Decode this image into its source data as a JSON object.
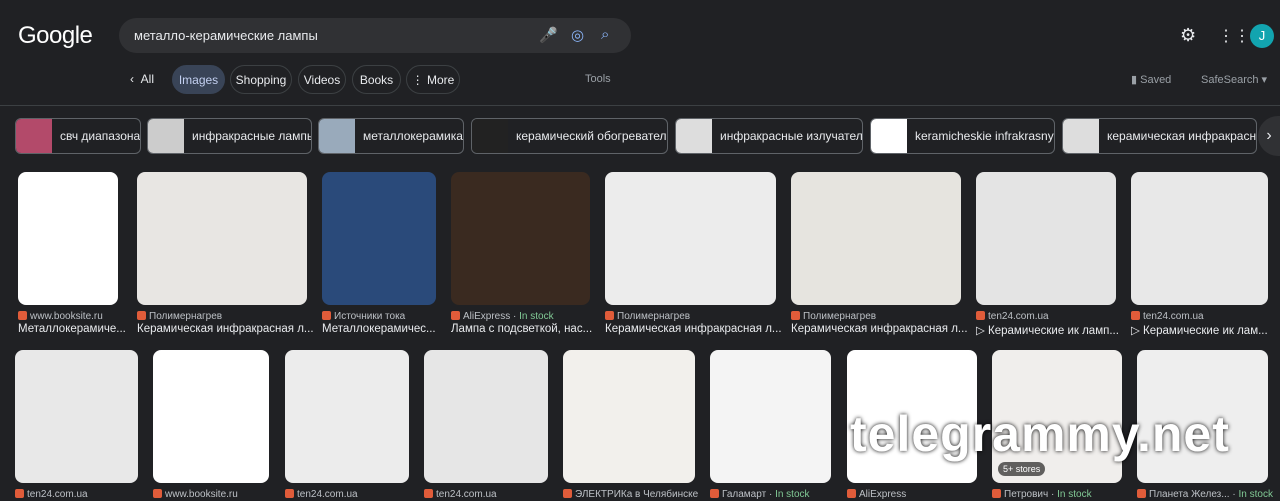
{
  "header": {
    "logo": "Google",
    "query": "металло-керамические лампы",
    "avatar": "J"
  },
  "tabs": [
    {
      "label": "All"
    },
    {
      "label": "Images"
    },
    {
      "label": "Shopping"
    },
    {
      "label": "Videos"
    },
    {
      "label": "Books"
    },
    {
      "label": "More"
    }
  ],
  "tools": "Tools",
  "saved": "Saved",
  "safesearch": "SafeSearch",
  "chips": [
    "свч диапазона",
    "инфракрасные лампы",
    "металлокерамика",
    "керамический обогреватель",
    "инфракрасные излучатели",
    "keramicheskie infrakrasnye",
    "керамическая инфракрасная"
  ],
  "row1": [
    {
      "source": "www.booksite.ru",
      "title": "Металлокерамиче..."
    },
    {
      "source": "Полимернагрев",
      "title": "Керамическая инфракрасная л..."
    },
    {
      "source": "Источники тока",
      "title": "Металлокерамичес..."
    },
    {
      "source": "AliExpress",
      "stock": "In stock",
      "title": "Лампа с подсветкой, нас..."
    },
    {
      "source": "Полимернагрев",
      "title": "Керамическая инфракрасная л..."
    },
    {
      "source": "Полимернагрев",
      "title": "Керамическая инфракрасная л..."
    },
    {
      "source": "ten24.com.ua",
      "title": "▷ Керамические ик ламп..."
    },
    {
      "source": "ten24.com.ua",
      "title": "▷ Керамические ик лам..."
    }
  ],
  "row2": [
    {
      "source": "ten24.com.ua"
    },
    {
      "source": "www.booksite.ru"
    },
    {
      "source": "ten24.com.ua"
    },
    {
      "source": "ten24.com.ua"
    },
    {
      "source": "ЭЛЕКТРИКа в Челябинске"
    },
    {
      "source": "Галамарт",
      "stock": "In stock"
    },
    {
      "source": "AliExpress"
    },
    {
      "source": "Петрович",
      "stock": "In stock",
      "badge": "5+ stores"
    },
    {
      "source": "Планета Желез...",
      "stock": "In stock"
    }
  ],
  "watermark": "telegrammy.net"
}
